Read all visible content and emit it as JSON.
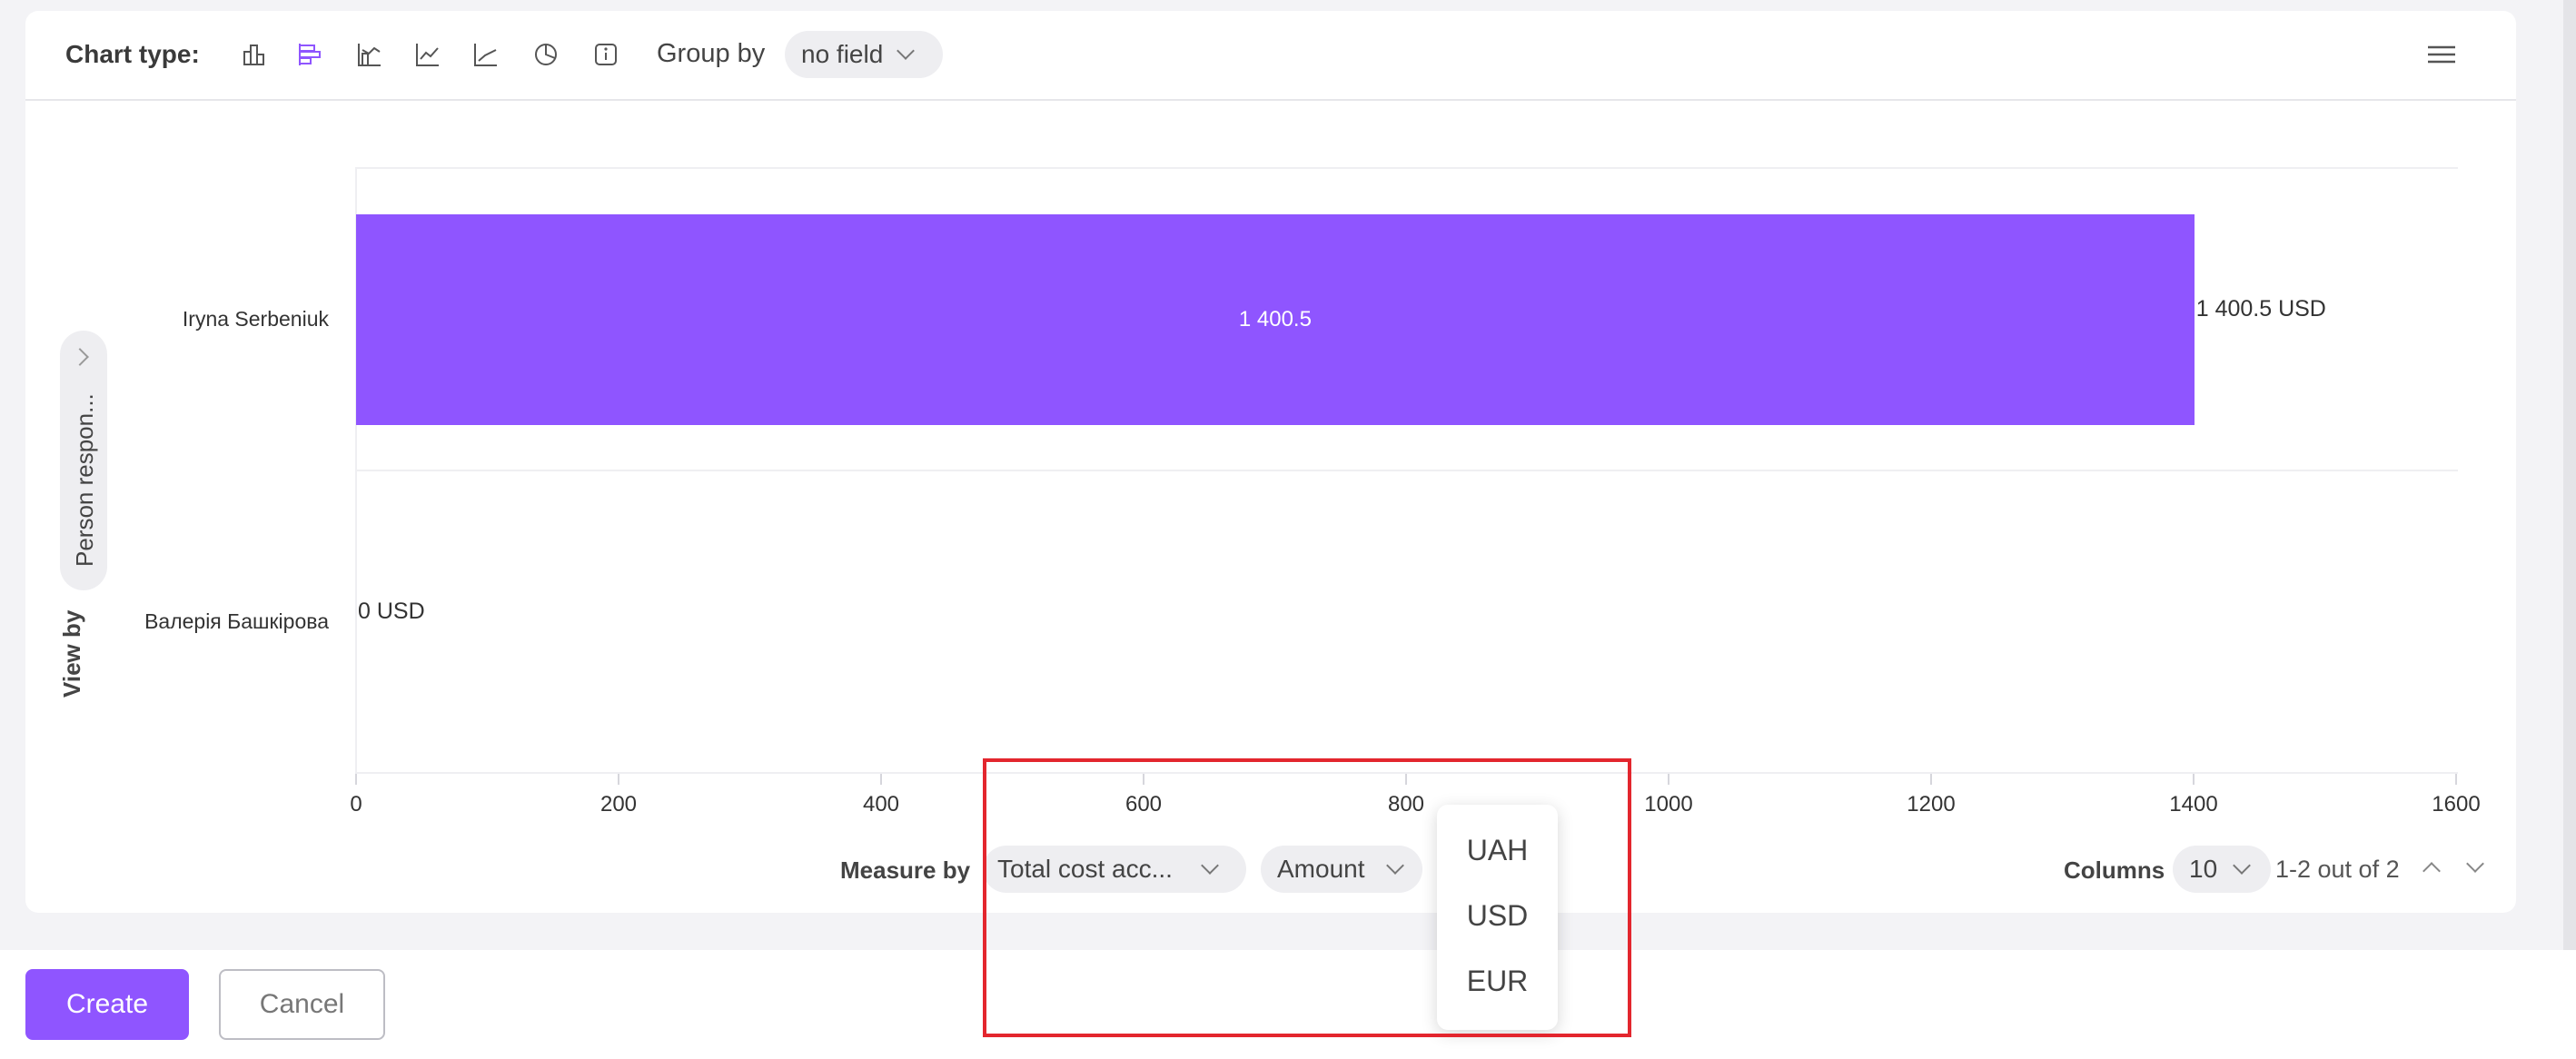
{
  "toolbar": {
    "chart_type_label": "Chart type:",
    "group_by_label": "Group by",
    "group_by_value": "no field",
    "chart_icons": [
      "bar-chart-icon",
      "horizontal-bar-chart-icon",
      "area-chart-icon",
      "line-chart-icon",
      "stacked-line-chart-icon",
      "pie-chart-icon",
      "info-icon"
    ],
    "active_chart_icon": "horizontal-bar-chart-icon",
    "menu_icon": "hamburger-menu-icon"
  },
  "view_by": {
    "label": "View by",
    "value": "Person respon..."
  },
  "chart_data": {
    "type": "bar",
    "orientation": "horizontal",
    "categories": [
      "Iryna Serbeniuk",
      "Валерія Башкірова"
    ],
    "values": [
      1400.5,
      0
    ],
    "bar_labels": [
      "1 400.5",
      ""
    ],
    "value_labels": [
      "1 400.5 USD",
      "0 USD"
    ],
    "xlim": [
      0,
      1600
    ],
    "x_ticks": [
      "0",
      "200",
      "400",
      "600",
      "800",
      "1000",
      "1200",
      "1400",
      "1600"
    ],
    "bar_color": "#8f55ff",
    "grid": true
  },
  "measure": {
    "label": "Measure by",
    "field_value": "Total cost acc...",
    "aggregate_value": "Amount"
  },
  "currency_dropdown": {
    "options": [
      "UAH",
      "USD",
      "EUR"
    ]
  },
  "pagination": {
    "columns_label": "Columns",
    "columns_value": "10",
    "range_text": "1-2 out of 2"
  },
  "footer": {
    "create_label": "Create",
    "cancel_label": "Cancel"
  },
  "colors": {
    "accent": "#8f55ff",
    "highlight_box": "#e3262e"
  }
}
